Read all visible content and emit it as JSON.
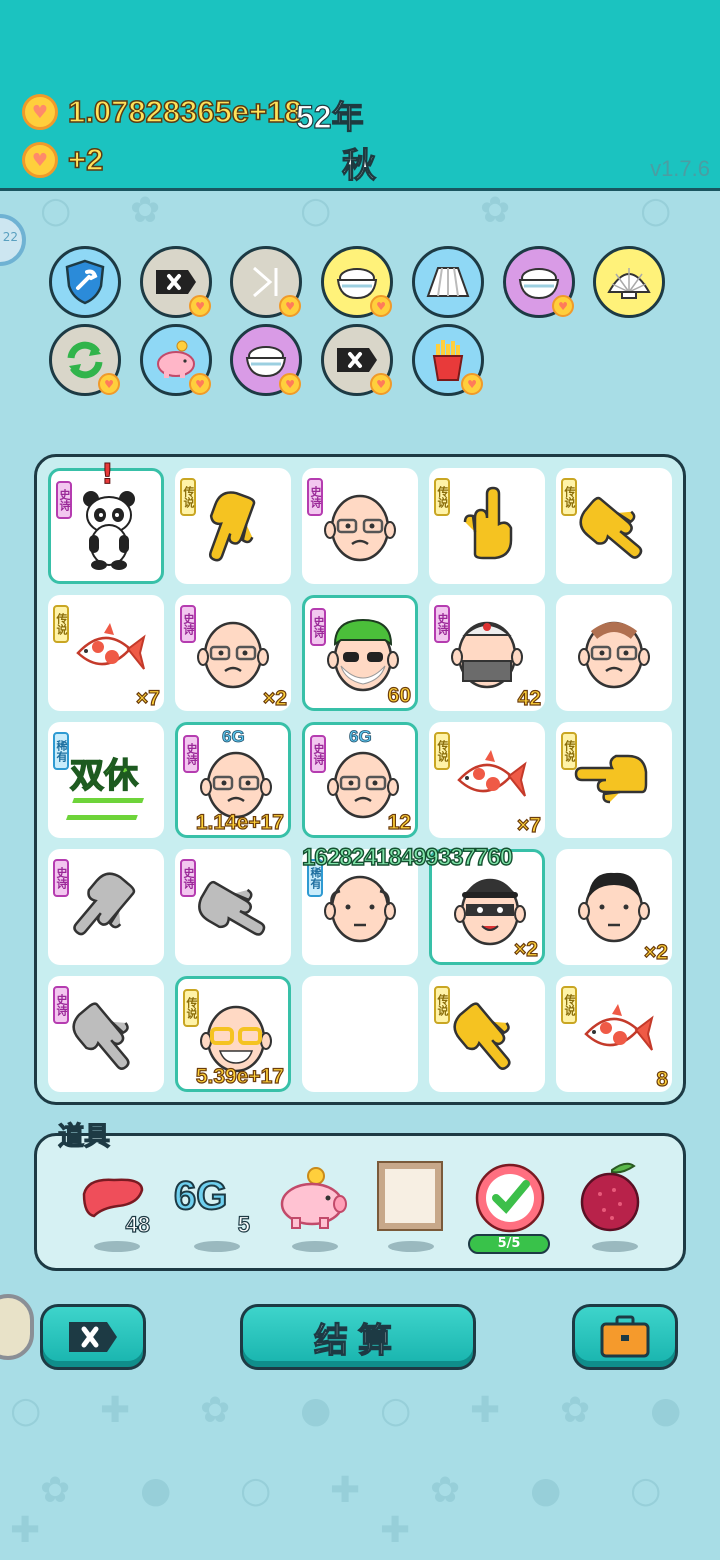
{
  "header": {
    "money": "1.07828365e+18",
    "income": "+2",
    "year": "52年",
    "season": "秋",
    "version": "v1.7.6",
    "side_badge": "22"
  },
  "buffs": [
    {
      "icon": "shield-wrench-icon",
      "bg": "#8fd8f5"
    },
    {
      "icon": "ad-skip-icon",
      "bg": "#d9d6c9"
    },
    {
      "icon": "skip-forward-icon",
      "bg": "#d9d6c9"
    },
    {
      "icon": "rice-bowl-icon",
      "bg": "#fff27a"
    },
    {
      "icon": "skirt-icon",
      "bg": "#8fd8f5"
    },
    {
      "icon": "rice-bowl-icon",
      "bg": "#d99be6"
    },
    {
      "icon": "shell-icon",
      "bg": "#fff27a"
    },
    {
      "icon": "refresh-icon",
      "bg": "#d9d6c9"
    },
    {
      "icon": "piggy-bank-icon",
      "bg": "#8fd8f5"
    },
    {
      "icon": "rice-bowl-icon",
      "bg": "#d99be6"
    },
    {
      "icon": "ad-skip-icon",
      "bg": "#d9d6c9"
    },
    {
      "icon": "fries-icon",
      "bg": "#8fd8f5"
    }
  ],
  "board": {
    "cells": [
      {
        "tag": "史诗",
        "tagType": "epic",
        "icon": "panda",
        "count": "",
        "hl": true,
        "alert": true
      },
      {
        "tag": "传说",
        "tagType": "legend",
        "icon": "hand-yellow",
        "count": ""
      },
      {
        "tag": "史诗",
        "tagType": "epic",
        "icon": "old-man",
        "count": ""
      },
      {
        "tag": "传说",
        "tagType": "legend",
        "icon": "hand-yellow-up",
        "count": ""
      },
      {
        "tag": "传说",
        "tagType": "legend",
        "icon": "hand-yellow-point",
        "count": ""
      },
      {
        "tag": "传说",
        "tagType": "legend",
        "icon": "koi",
        "count": "×7"
      },
      {
        "tag": "史诗",
        "tagType": "epic",
        "icon": "old-man",
        "count": "×2"
      },
      {
        "tag": "史诗",
        "tagType": "epic",
        "icon": "green-hair-man",
        "count": "60",
        "hl": true
      },
      {
        "tag": "史诗",
        "tagType": "epic",
        "icon": "beard-man",
        "count": "42"
      },
      {
        "tag": "",
        "tagType": "",
        "icon": "striped-hair-man",
        "count": ""
      },
      {
        "tag": "稀有",
        "tagType": "rare",
        "icon": "double-rest",
        "count": "",
        "label": "双休"
      },
      {
        "tag": "史诗",
        "tagType": "epic",
        "icon": "old-man",
        "count": "1.14e+17",
        "hl": true,
        "g6": "6G"
      },
      {
        "tag": "史诗",
        "tagType": "epic",
        "icon": "old-man",
        "count": "12",
        "hl": true,
        "g6": "6G"
      },
      {
        "tag": "传说",
        "tagType": "legend",
        "icon": "koi",
        "count": "×7"
      },
      {
        "tag": "传说",
        "tagType": "legend",
        "icon": "hand-yellow-flat",
        "count": ""
      },
      {
        "tag": "史诗",
        "tagType": "epic",
        "icon": "hand-gray",
        "count": ""
      },
      {
        "tag": "史诗",
        "tagType": "epic",
        "icon": "hand-gray-point",
        "count": ""
      },
      {
        "tag": "稀有",
        "tagType": "rare",
        "icon": "bald-man",
        "count": ""
      },
      {
        "tag": "",
        "tagType": "",
        "icon": "thief",
        "count": "×2",
        "hl": true
      },
      {
        "tag": "",
        "tagType": "",
        "icon": "young-man",
        "count": "×2"
      },
      {
        "tag": "史诗",
        "tagType": "epic",
        "icon": "hand-gray-down",
        "count": ""
      },
      {
        "tag": "传说",
        "tagType": "legend",
        "icon": "gold-glasses-man",
        "count": "5.39e+17",
        "hl": true
      },
      {
        "tag": "",
        "tagType": "",
        "icon": "empty",
        "count": ""
      },
      {
        "tag": "传说",
        "tagType": "legend",
        "icon": "hand-yellow-down",
        "count": ""
      },
      {
        "tag": "传说",
        "tagType": "legend",
        "icon": "koi",
        "count": "8"
      }
    ],
    "big_value": "16282418499337760"
  },
  "items": {
    "title": "道具",
    "list": [
      {
        "icon": "liver-icon",
        "count": "48"
      },
      {
        "icon": "6g-icon",
        "label": "6G",
        "count": "5"
      },
      {
        "icon": "piggy-bank-icon",
        "count": ""
      },
      {
        "icon": "frame-icon",
        "count": ""
      },
      {
        "icon": "check-badge-icon",
        "count": "",
        "progress": "5/5"
      },
      {
        "icon": "bayberry-icon",
        "count": ""
      }
    ]
  },
  "buttons": {
    "settle": "结算"
  }
}
